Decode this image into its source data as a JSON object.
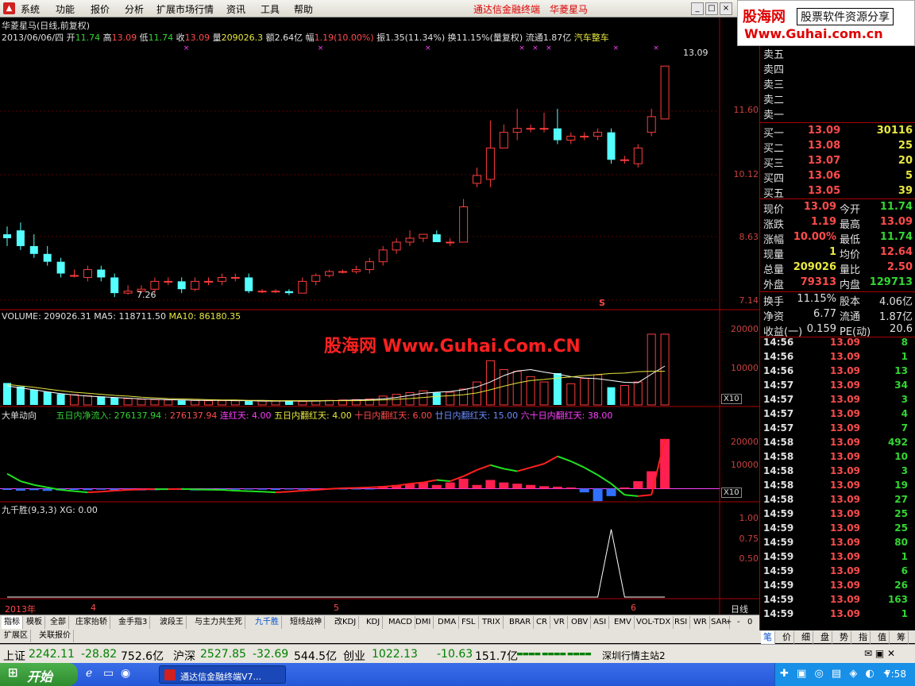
{
  "menu": [
    "系统",
    "功能",
    "报价",
    "分析",
    "扩展市场行情",
    "资讯",
    "工具",
    "帮助"
  ],
  "app_title": "通达信金融终端",
  "stock_name": "华菱星马",
  "brand": {
    "line1": "股海网",
    "line2": "股票软件资源分享",
    "line3": "Www.Guhai.com.cn"
  },
  "chart_header": {
    "title": "华菱星马(日线,前复权)",
    "date": "2013/06/06/四",
    "open_l": "开",
    "open": "11.74",
    "high_l": "高",
    "high": "13.09",
    "low_l": "低",
    "low": "11.74",
    "close_l": "收",
    "close": "13.09",
    "vol_l": "量",
    "vol": "209026.3",
    "amount_l": "额",
    "amount": "2.64亿",
    "chg_l": "幅",
    "chg": "1.19(10.00%)",
    "amp_l": "振",
    "amp": "1.35(11.34%)",
    "turn_l": "换",
    "turn": "11.15%(量复权)",
    "float_l": "流通",
    "float": "1.87亿",
    "sector": "汽车整车"
  },
  "price_axis": [
    "11.60",
    "10.12",
    "8.63",
    "7.14"
  ],
  "price_annotations": {
    "max": "13.09",
    "min": "7.26",
    "marker": "S"
  },
  "volume_header": {
    "v": "VOLUME: 209026.31",
    "ma5": "MA5: 118711.50",
    "ma10": "MA10: 86180.35"
  },
  "volume_axis": [
    "20000",
    "10000"
  ],
  "x10_label": "X10",
  "watermark": "股海网 Www.Guhai.Com.CN",
  "flow_header": {
    "name": "大单动向",
    "net5": "五日内净流入: 276137.94",
    "val2": ": 276137.94",
    "streak": "连红天: 4.00",
    "red5": "五日内翻红天: 4.00",
    "red10": "十日内翻红天: 6.00",
    "red20": "廿日内翻红天: 15.00",
    "red60": "六十日内翻红天: 38.00"
  },
  "flow_axis": [
    "20000",
    "10000"
  ],
  "jqs_header": {
    "name": "九千胜(9,3,3)",
    "xg": "XG: 0.00"
  },
  "jqs_axis": [
    "1.00",
    "0.75",
    "0.50"
  ],
  "time_axis": {
    "y": "2013年",
    "m4": "4",
    "m5": "5",
    "m6": "6",
    "period": "日线"
  },
  "chart_data": {
    "type": "candlestick",
    "candles": [
      [
        8.8,
        8.7,
        9.0,
        8.5
      ],
      [
        8.9,
        8.5,
        9.1,
        8.4
      ],
      [
        8.5,
        8.3,
        8.8,
        8.2
      ],
      [
        8.3,
        8.1,
        8.5,
        8.0
      ],
      [
        8.1,
        7.8,
        8.2,
        7.7
      ],
      [
        7.75,
        7.75,
        7.9,
        7.7
      ],
      [
        7.7,
        7.9,
        8.0,
        7.6
      ],
      [
        7.9,
        7.7,
        8.0,
        7.6
      ],
      [
        7.7,
        7.3,
        7.8,
        7.2
      ],
      [
        7.3,
        7.35,
        7.5,
        7.26
      ],
      [
        7.35,
        7.4,
        7.5,
        7.3
      ],
      [
        7.4,
        7.6,
        7.7,
        7.3
      ],
      [
        7.6,
        7.6,
        7.7,
        7.5
      ],
      [
        7.6,
        7.4,
        7.7,
        7.3
      ],
      [
        7.4,
        7.6,
        7.7,
        7.35
      ],
      [
        7.6,
        7.6,
        7.7,
        7.5
      ],
      [
        7.6,
        7.7,
        7.8,
        7.5
      ],
      [
        7.7,
        7.7,
        7.8,
        7.6
      ],
      [
        7.7,
        7.35,
        7.8,
        7.3
      ],
      [
        7.35,
        7.35,
        7.4,
        7.3
      ],
      [
        7.35,
        7.35,
        7.4,
        7.3
      ],
      [
        7.35,
        7.3,
        7.4,
        7.25
      ],
      [
        7.3,
        7.6,
        7.7,
        7.3
      ],
      [
        7.6,
        7.75,
        7.8,
        7.5
      ],
      [
        7.75,
        7.85,
        7.9,
        7.7
      ],
      [
        7.85,
        7.85,
        7.9,
        7.8
      ],
      [
        7.85,
        7.9,
        8.0,
        7.8
      ],
      [
        7.9,
        8.1,
        8.2,
        7.8
      ],
      [
        8.1,
        8.4,
        8.5,
        8.0
      ],
      [
        8.4,
        8.6,
        8.7,
        8.3
      ],
      [
        8.6,
        8.7,
        8.9,
        8.5
      ],
      [
        8.7,
        8.8,
        8.8,
        8.6
      ],
      [
        8.8,
        8.6,
        8.9,
        8.6
      ],
      [
        8.6,
        8.6,
        8.7,
        8.5
      ],
      [
        8.6,
        9.5,
        9.7,
        8.6
      ],
      [
        10.1,
        10.3,
        10.5,
        10.0
      ],
      [
        10.2,
        11.0,
        11.7,
        10.0
      ],
      [
        11.0,
        11.4,
        11.6,
        11.0
      ],
      [
        11.4,
        11.5,
        12.0,
        11.2
      ],
      [
        11.5,
        11.5,
        11.6,
        11.4
      ],
      [
        11.5,
        11.5,
        11.9,
        11.4
      ],
      [
        11.5,
        11.2,
        12.0,
        11.1
      ],
      [
        11.2,
        11.3,
        11.4,
        11.1
      ],
      [
        11.3,
        11.3,
        11.4,
        11.2
      ],
      [
        11.3,
        11.4,
        11.5,
        11.2
      ],
      [
        11.4,
        10.7,
        11.5,
        10.6
      ],
      [
        10.7,
        10.7,
        10.8,
        10.6
      ],
      [
        10.6,
        11.0,
        11.1,
        10.5
      ],
      [
        11.4,
        11.8,
        12.0,
        11.3
      ],
      [
        11.74,
        13.09,
        13.09,
        11.74
      ]
    ],
    "candle_fields": [
      "open",
      "close",
      "high",
      "low"
    ],
    "volume": [
      6200,
      5200,
      4300,
      3700,
      3100,
      2900,
      2600,
      2400,
      2100,
      1800,
      1600,
      1500,
      1400,
      1300,
      1300,
      1200,
      1200,
      1200,
      1100,
      1100,
      1100,
      1000,
      1000,
      1200,
      1300,
      1400,
      1500,
      1700,
      2500,
      3000,
      3500,
      4000,
      3500,
      3600,
      4500,
      6500,
      12500,
      10000,
      9500,
      8000,
      6500,
      9000,
      6000,
      7500,
      8500,
      5000,
      5500,
      6500,
      20000,
      20000
    ],
    "ma5": [
      5400,
      4800,
      4300,
      3700,
      3200,
      2800,
      2500,
      2300,
      2100,
      1900,
      1700,
      1600,
      1500,
      1400,
      1300,
      1300,
      1300,
      1200,
      1200,
      1100,
      1100,
      1100,
      1100,
      1100,
      1200,
      1300,
      1400,
      1500,
      1700,
      2100,
      2700,
      3300,
      3600,
      3800,
      4300,
      5100,
      6500,
      8300,
      9600,
      10000,
      9300,
      8700,
      8000,
      7600,
      7400,
      6900,
      6400,
      6300,
      8700,
      11000
    ],
    "ma10": [
      5800,
      5400,
      5000,
      4500,
      4000,
      3600,
      3300,
      3000,
      2700,
      2500,
      2200,
      2000,
      1800,
      1700,
      1600,
      1500,
      1400,
      1400,
      1300,
      1300,
      1200,
      1200,
      1200,
      1200,
      1200,
      1200,
      1200,
      1300,
      1400,
      1600,
      1800,
      2100,
      2400,
      2600,
      2900,
      3400,
      4300,
      5300,
      6200,
      6900,
      7200,
      7600,
      7900,
      8300,
      8600,
      8900,
      9000,
      9400,
      9500,
      9500
    ],
    "flow_bars": [
      -500,
      -800,
      -600,
      -900,
      -700,
      -500,
      -600,
      -400,
      -600,
      -500,
      -700,
      -600,
      -400,
      -500,
      -700,
      -600,
      -500,
      -400,
      -300,
      -400,
      -500,
      -300,
      -400,
      -500,
      -300,
      -200,
      -300,
      -200,
      1000,
      1500,
      2000,
      2500,
      1500,
      2500,
      4000,
      1500,
      3500,
      2500,
      2000,
      1500,
      1000,
      800,
      500,
      -1500,
      -5000,
      -3000,
      500,
      3000,
      7000,
      20000
    ],
    "flow_line": [
      6000,
      3000,
      1500,
      500,
      -500,
      -1000,
      -1500,
      -1200,
      -800,
      -500,
      -300,
      -200,
      -200,
      -100,
      -300,
      -400,
      -500,
      -800,
      -1000,
      -1200,
      -1500,
      -1200,
      -800,
      -500,
      -100,
      200,
      300,
      500,
      800,
      1200,
      2000,
      2500,
      3500,
      3000,
      5000,
      7500,
      9500,
      8000,
      7000,
      8500,
      10000,
      13000,
      11000,
      8500,
      5500,
      2000,
      -2500,
      -3000,
      -2500,
      20000
    ],
    "xg": [
      0,
      0,
      0,
      0,
      0,
      0,
      0,
      0,
      0,
      0,
      0,
      0,
      0,
      0,
      0,
      0,
      0,
      0,
      0,
      0,
      0,
      0,
      0,
      0,
      0,
      0,
      0,
      0,
      0,
      0,
      0,
      0,
      0,
      0,
      0,
      0,
      0,
      0,
      0,
      0,
      0,
      0,
      0,
      0,
      0,
      1.0,
      0,
      0,
      0,
      0
    ],
    "price_ylim": [
      7.0,
      13.6
    ],
    "volume_ylim": [
      0,
      22000
    ],
    "flow_ylim": [
      -4000,
      26000
    ],
    "xg_ylim": [
      0,
      1.15
    ]
  },
  "order_book": {
    "sell": [
      {
        "l": "卖五"
      },
      {
        "l": "卖四"
      },
      {
        "l": "卖三"
      },
      {
        "l": "卖二"
      },
      {
        "l": "卖一"
      }
    ],
    "buy": [
      {
        "l": "买一",
        "p": "13.09",
        "v": "30116"
      },
      {
        "l": "买二",
        "p": "13.08",
        "v": "25"
      },
      {
        "l": "买三",
        "p": "13.07",
        "v": "20"
      },
      {
        "l": "买四",
        "p": "13.06",
        "v": "5"
      },
      {
        "l": "买五",
        "p": "13.05",
        "v": "39"
      }
    ]
  },
  "quote": [
    {
      "a": "现价",
      "av": "13.09",
      "b": "今开",
      "bv": "11.74"
    },
    {
      "a": "涨跌",
      "av": "1.19",
      "b": "最高",
      "bv": "13.09"
    },
    {
      "a": "涨幅",
      "av": "10.00%",
      "b": "最低",
      "bv": "11.74"
    },
    {
      "a": "现量",
      "av": "1",
      "b": "均价",
      "bv": "12.64"
    },
    {
      "a": "总量",
      "av": "209026",
      "b": "量比",
      "bv": "2.50"
    },
    {
      "a": "外盘",
      "av": "79313",
      "b": "内盘",
      "bv": "129713"
    }
  ],
  "quote2": [
    {
      "a": "换手",
      "av": "11.15%",
      "b": "股本",
      "bv": "4.06亿"
    },
    {
      "a": "净资",
      "av": "6.77",
      "b": "流通",
      "bv": "1.87亿"
    },
    {
      "a": "收益(一)",
      "av": "0.159",
      "b": "PE(动)",
      "bv": "20.6"
    }
  ],
  "ticks": [
    {
      "t": "14:56",
      "p": "13.09",
      "v": "8"
    },
    {
      "t": "14:56",
      "p": "13.09",
      "v": "1"
    },
    {
      "t": "14:56",
      "p": "13.09",
      "v": "13"
    },
    {
      "t": "14:57",
      "p": "13.09",
      "v": "34"
    },
    {
      "t": "14:57",
      "p": "13.09",
      "v": "3"
    },
    {
      "t": "14:57",
      "p": "13.09",
      "v": "4"
    },
    {
      "t": "14:57",
      "p": "13.09",
      "v": "7"
    },
    {
      "t": "14:58",
      "p": "13.09",
      "v": "492"
    },
    {
      "t": "14:58",
      "p": "13.09",
      "v": "10"
    },
    {
      "t": "14:58",
      "p": "13.09",
      "v": "3"
    },
    {
      "t": "14:58",
      "p": "13.09",
      "v": "19"
    },
    {
      "t": "14:58",
      "p": "13.09",
      "v": "27"
    },
    {
      "t": "14:59",
      "p": "13.09",
      "v": "25"
    },
    {
      "t": "14:59",
      "p": "13.09",
      "v": "25"
    },
    {
      "t": "14:59",
      "p": "13.09",
      "v": "80"
    },
    {
      "t": "14:59",
      "p": "13.09",
      "v": "1"
    },
    {
      "t": "14:59",
      "p": "13.09",
      "v": "6"
    },
    {
      "t": "14:59",
      "p": "13.09",
      "v": "26"
    },
    {
      "t": "14:59",
      "p": "13.09",
      "v": "163"
    },
    {
      "t": "14:59",
      "p": "13.09",
      "v": "1"
    }
  ],
  "indicator_tabs": [
    "指标",
    "模板",
    "全部",
    "庄家抬轿",
    "金手指3",
    "波段王",
    "与主力共生死",
    "九千胜",
    "短线战神",
    "改KDJ",
    "KDJ",
    "MACD",
    "DMI",
    "DMA",
    "FSL",
    "TRIX",
    "BRAR",
    "CR",
    "VR",
    "OBV",
    "ASI",
    "EMV",
    "VOL-TDX",
    "RSI",
    "WR",
    "SAR"
  ],
  "tab_ctrl": [
    "+",
    "-",
    "0"
  ],
  "tabs2": [
    "扩展区",
    "关联报价"
  ],
  "side_tabs": [
    "笔",
    "价",
    "细",
    "盘",
    "势",
    "指",
    "值",
    "筹"
  ],
  "index_bar": {
    "sh_l": "上证",
    "sh": "2242.11",
    "sh_c": "-28.82",
    "sh_a": "752.6亿",
    "hs_l": "沪深",
    "hs": "2527.85",
    "hs_c": "-32.69",
    "hs_a": "544.5亿",
    "cy_l": "创业",
    "cy": "1022.13",
    "cy_c": "-10.63",
    "cy_a": "151.7亿",
    "server": "深圳行情主站2"
  },
  "taskbar": {
    "start": "开始",
    "task": "通达信金融终端V7...",
    "clock": "7:58"
  }
}
